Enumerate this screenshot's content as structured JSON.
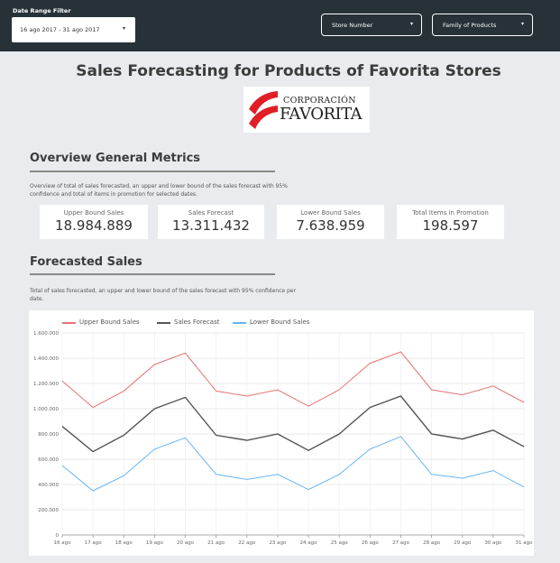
{
  "filters": {
    "date_range_title": "Date Range Filter",
    "date_range_value": "16 ago 2017 - 31 ago 2017",
    "store_number": "Store Number",
    "family_of_products": "Family of Products"
  },
  "page_title": "Sales Forecasting for Products of Favorita Stores",
  "logo": {
    "line1": "CORPORACIÓN",
    "line2": "FAVORITA",
    "color": "#e01e26"
  },
  "overview": {
    "title": "Overview General Metrics",
    "description": "Overview of total of sales forecasted,  an upper and lower bound of the sales forecast with 95% confidence and total of items in promotion for selected dates.",
    "metrics": [
      {
        "label": "Upper Bound Sales",
        "value": "18.984.889"
      },
      {
        "label": "Sales Forecast",
        "value": "13.311.432"
      },
      {
        "label": "Lower Bound Sales",
        "value": "7.638.959"
      },
      {
        "label": "Total Items in Promotion",
        "value": "198.597"
      }
    ]
  },
  "forecast": {
    "title": "Forecasted Sales",
    "description": "Total of sales forecasted,  an upper and lower bound of the sales forecast with 95% confidence per date."
  },
  "chart_data": {
    "type": "line",
    "categories": [
      "16 ago",
      "17 ago",
      "18 ago",
      "19 ago",
      "20 ago",
      "21 ago",
      "22 ago",
      "23 ago",
      "24 ago",
      "25 ago",
      "26 ago",
      "27 ago",
      "28 ago",
      "29 ago",
      "30 ago",
      "31 ago"
    ],
    "series": [
      {
        "name": "Upper Bound Sales",
        "color": "#e57373",
        "values": [
          1220000,
          1010000,
          1140000,
          1350000,
          1440000,
          1140000,
          1100000,
          1150000,
          1020000,
          1150000,
          1360000,
          1450000,
          1150000,
          1110000,
          1180000,
          1050000
        ]
      },
      {
        "name": "Sales Forecast",
        "color": "#555555",
        "values": [
          860000,
          660000,
          790000,
          1000000,
          1090000,
          790000,
          750000,
          800000,
          670000,
          800000,
          1010000,
          1100000,
          800000,
          760000,
          830000,
          700000
        ]
      },
      {
        "name": "Lower Bound Sales",
        "color": "#64b5f6",
        "values": [
          550000,
          350000,
          470000,
          680000,
          770000,
          480000,
          440000,
          480000,
          360000,
          480000,
          680000,
          780000,
          480000,
          450000,
          510000,
          380000
        ]
      }
    ],
    "y_ticks": [
      "0",
      "200.000",
      "400.000",
      "600.000",
      "800.000",
      "1.000.000",
      "1.200.000",
      "1.400.000",
      "1.600.000"
    ],
    "ylim": [
      0,
      1600000
    ],
    "grid": true,
    "legend_position": "top-left"
  }
}
